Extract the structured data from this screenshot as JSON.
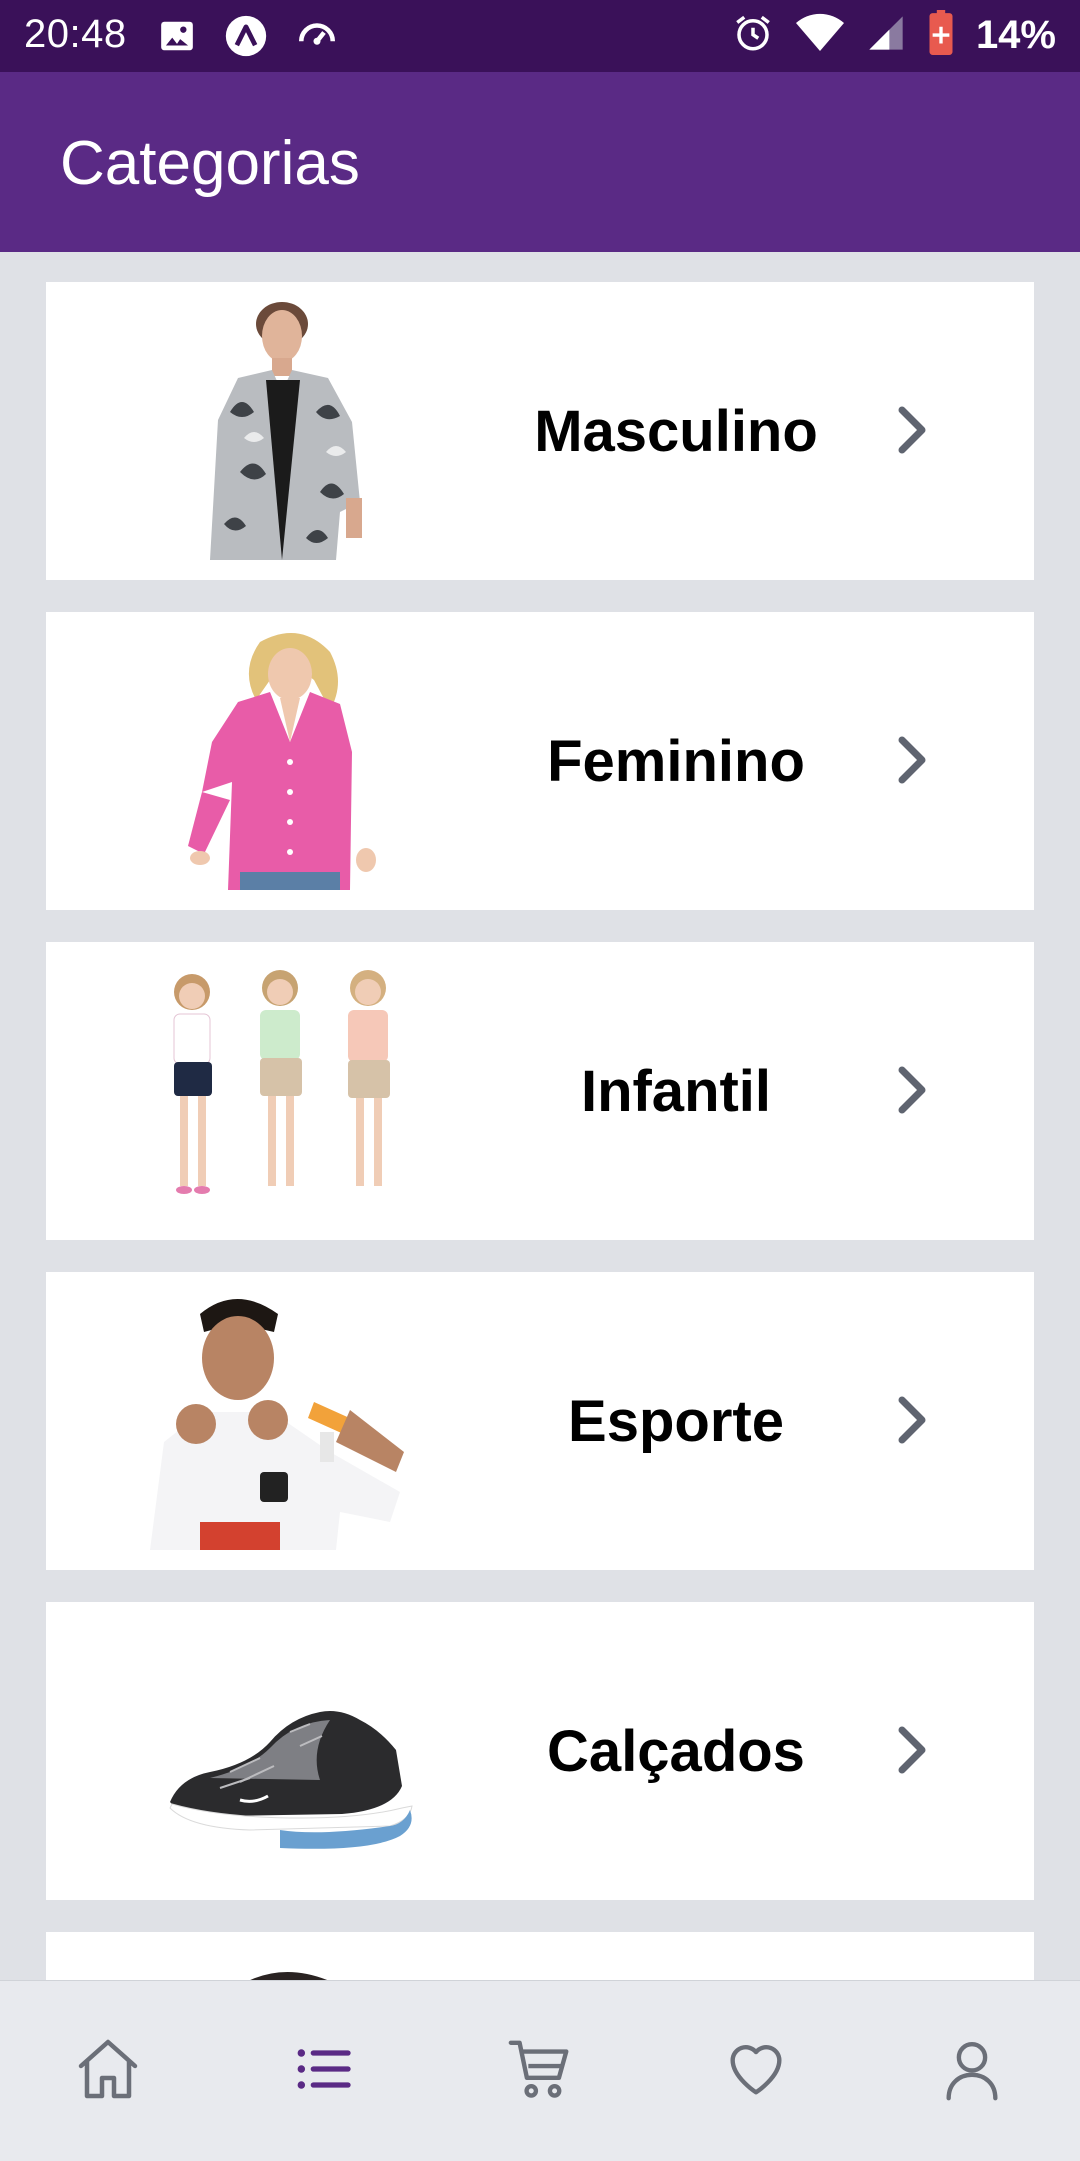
{
  "status_bar": {
    "time": "20:48",
    "battery_percent": "14%",
    "icons_left": [
      "image-icon",
      "app-logo-icon",
      "speedometer-icon"
    ],
    "icons_right": [
      "alarm-icon",
      "wifi-icon",
      "signal-icon",
      "battery-icon"
    ]
  },
  "app_bar": {
    "title": "Categorias"
  },
  "categories": [
    {
      "label": "Masculino",
      "image": "men-shirt-photo"
    },
    {
      "label": "Feminino",
      "image": "women-blouse-photo"
    },
    {
      "label": "Infantil",
      "image": "kids-outfits-photo"
    },
    {
      "label": "Esporte",
      "image": "football-player-photo"
    },
    {
      "label": "Calçados",
      "image": "sneaker-photo"
    },
    {
      "label": "",
      "image": "partial-item-photo"
    }
  ],
  "bottom_nav": {
    "items": [
      {
        "name": "home-icon",
        "active": false
      },
      {
        "name": "list-icon",
        "active": true
      },
      {
        "name": "cart-icon",
        "active": false
      },
      {
        "name": "heart-icon",
        "active": false
      },
      {
        "name": "user-icon",
        "active": false
      }
    ],
    "active_color": "#5a2a85",
    "inactive_color": "#6b6f78"
  },
  "colors": {
    "status_bar": "#3a1159",
    "app_bar": "#5a2a85",
    "background": "#dfe1e6",
    "chevron": "#5f6470"
  }
}
